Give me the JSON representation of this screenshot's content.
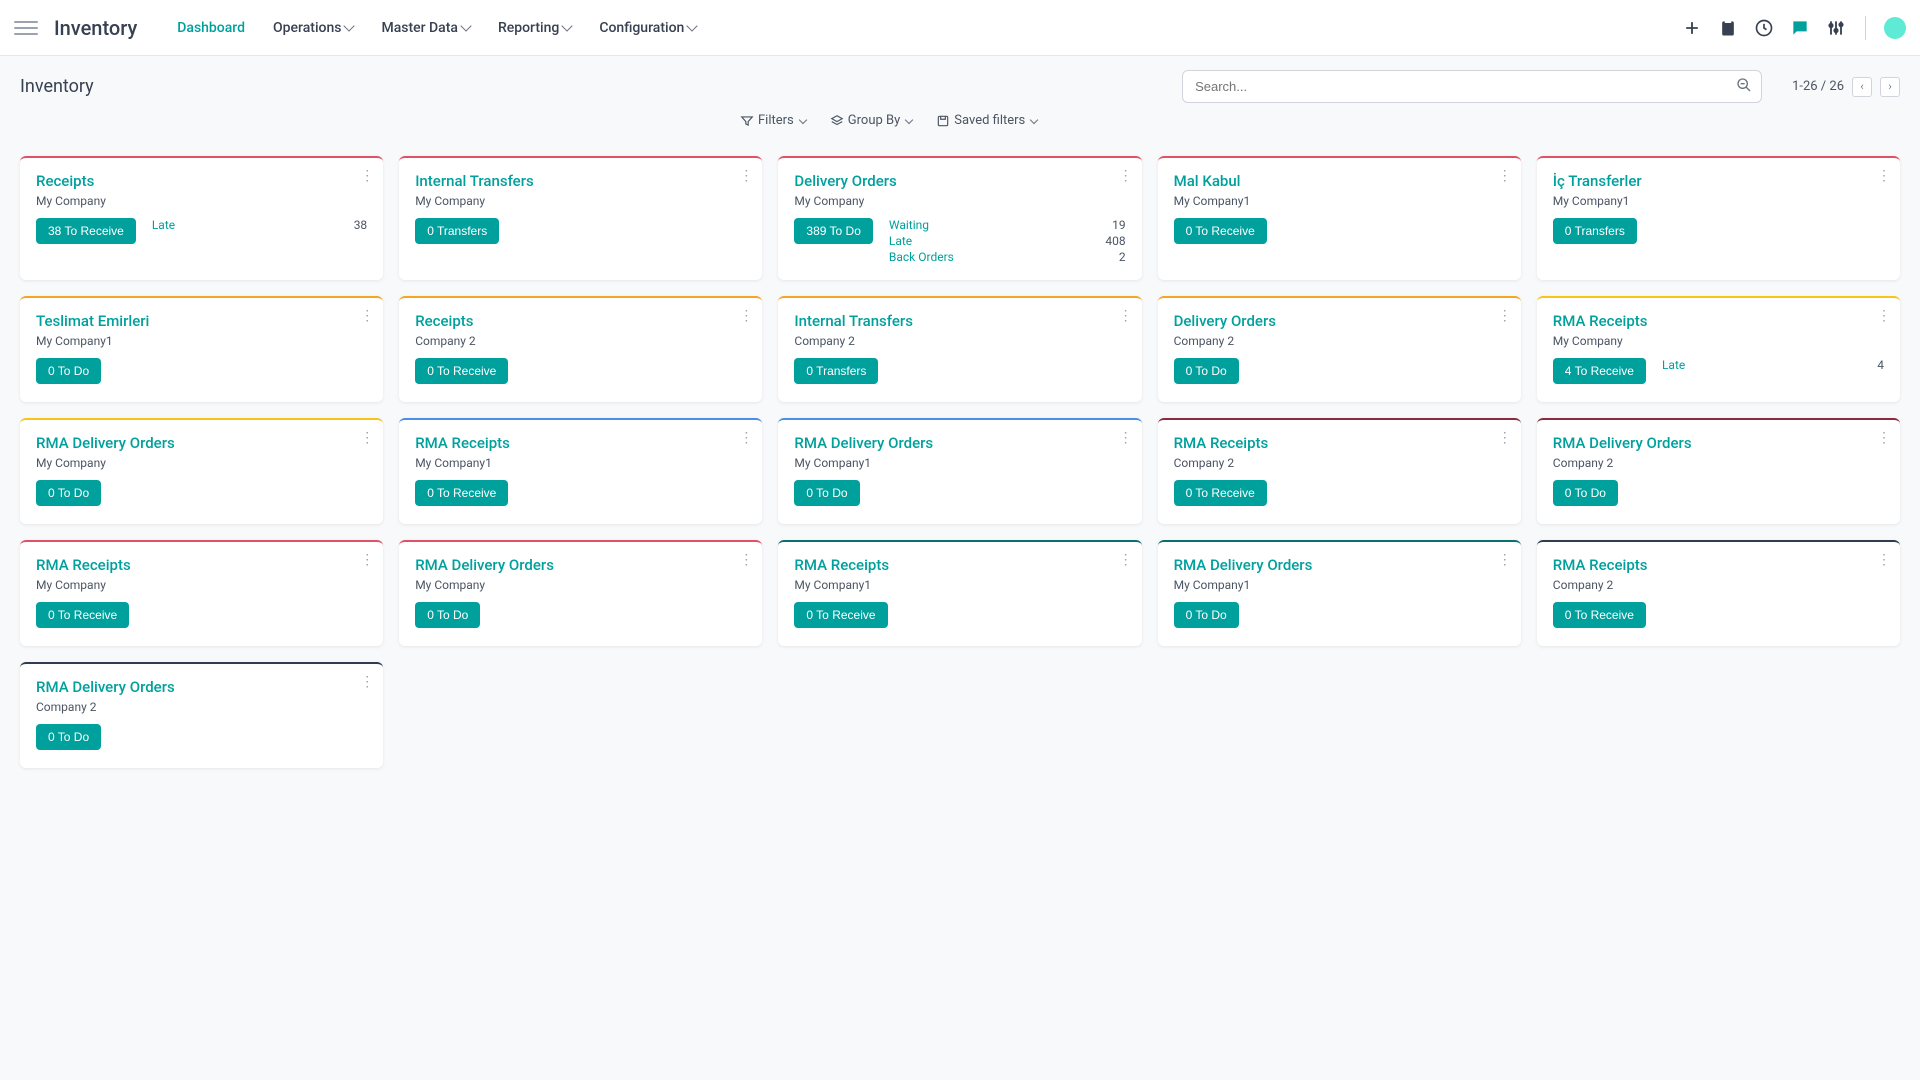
{
  "app": {
    "title": "Inventory"
  },
  "nav": {
    "items": [
      {
        "label": "Dashboard",
        "active": true,
        "dropdown": false
      },
      {
        "label": "Operations",
        "active": false,
        "dropdown": true
      },
      {
        "label": "Master Data",
        "active": false,
        "dropdown": true
      },
      {
        "label": "Reporting",
        "active": false,
        "dropdown": true
      },
      {
        "label": "Configuration",
        "active": false,
        "dropdown": true
      }
    ]
  },
  "page": {
    "title": "Inventory"
  },
  "search": {
    "placeholder": "Search..."
  },
  "pager": {
    "text": "1-26 / 26"
  },
  "filters": {
    "filters_label": "Filters",
    "groupby_label": "Group By",
    "saved_label": "Saved filters"
  },
  "border_colors": {
    "red": "#e05263",
    "orange": "#f5a623",
    "yellow": "#f5c518",
    "blue": "#4a90e2",
    "darkred": "#8b2c3e",
    "teal": "#0d6e6e",
    "navy": "#2c3e50",
    "gray": "#6b7280"
  },
  "cards": [
    {
      "title": "Receipts",
      "sub": "My Company",
      "button": "38 To Receive",
      "border": "red",
      "stats": [
        {
          "label": "Late",
          "val": "38"
        }
      ]
    },
    {
      "title": "Internal Transfers",
      "sub": "My Company",
      "button": "0 Transfers",
      "border": "red",
      "stats": []
    },
    {
      "title": "Delivery Orders",
      "sub": "My Company",
      "button": "389 To Do",
      "border": "red",
      "stats": [
        {
          "label": "Waiting",
          "val": "19"
        },
        {
          "label": "Late",
          "val": "408"
        },
        {
          "label": "Back Orders",
          "val": "2"
        }
      ]
    },
    {
      "title": "Mal Kabul",
      "sub": "My Company1",
      "button": "0 To Receive",
      "border": "red",
      "stats": []
    },
    {
      "title": "İç Transferler",
      "sub": "My Company1",
      "button": "0 Transfers",
      "border": "red",
      "stats": []
    },
    {
      "title": "Teslimat Emirleri",
      "sub": "My Company1",
      "button": "0 To Do",
      "border": "orange",
      "stats": []
    },
    {
      "title": "Receipts",
      "sub": "Company 2",
      "button": "0 To Receive",
      "border": "orange",
      "stats": []
    },
    {
      "title": "Internal Transfers",
      "sub": "Company 2",
      "button": "0 Transfers",
      "border": "orange",
      "stats": []
    },
    {
      "title": "Delivery Orders",
      "sub": "Company 2",
      "button": "0 To Do",
      "border": "orange",
      "stats": []
    },
    {
      "title": "RMA Receipts",
      "sub": "My Company",
      "button": "4 To Receive",
      "border": "yellow",
      "stats": [
        {
          "label": "Late",
          "val": "4"
        }
      ]
    },
    {
      "title": "RMA Delivery Orders",
      "sub": "My Company",
      "button": "0 To Do",
      "border": "yellow",
      "stats": []
    },
    {
      "title": "RMA Receipts",
      "sub": "My Company1",
      "button": "0 To Receive",
      "border": "blue",
      "stats": []
    },
    {
      "title": "RMA Delivery Orders",
      "sub": "My Company1",
      "button": "0 To Do",
      "border": "blue",
      "stats": []
    },
    {
      "title": "RMA Receipts",
      "sub": "Company 2",
      "button": "0 To Receive",
      "border": "darkred",
      "stats": []
    },
    {
      "title": "RMA Delivery Orders",
      "sub": "Company 2",
      "button": "0 To Do",
      "border": "darkred",
      "stats": []
    },
    {
      "title": "RMA Receipts",
      "sub": "My Company",
      "button": "0 To Receive",
      "border": "red",
      "stats": []
    },
    {
      "title": "RMA Delivery Orders",
      "sub": "My Company",
      "button": "0 To Do",
      "border": "red",
      "stats": []
    },
    {
      "title": "RMA Receipts",
      "sub": "My Company1",
      "button": "0 To Receive",
      "border": "teal",
      "stats": []
    },
    {
      "title": "RMA Delivery Orders",
      "sub": "My Company1",
      "button": "0 To Do",
      "border": "teal",
      "stats": []
    },
    {
      "title": "RMA Receipts",
      "sub": "Company 2",
      "button": "0 To Receive",
      "border": "navy",
      "stats": []
    },
    {
      "title": "RMA Delivery Orders",
      "sub": "Company 2",
      "button": "0 To Do",
      "border": "navy",
      "stats": []
    }
  ]
}
